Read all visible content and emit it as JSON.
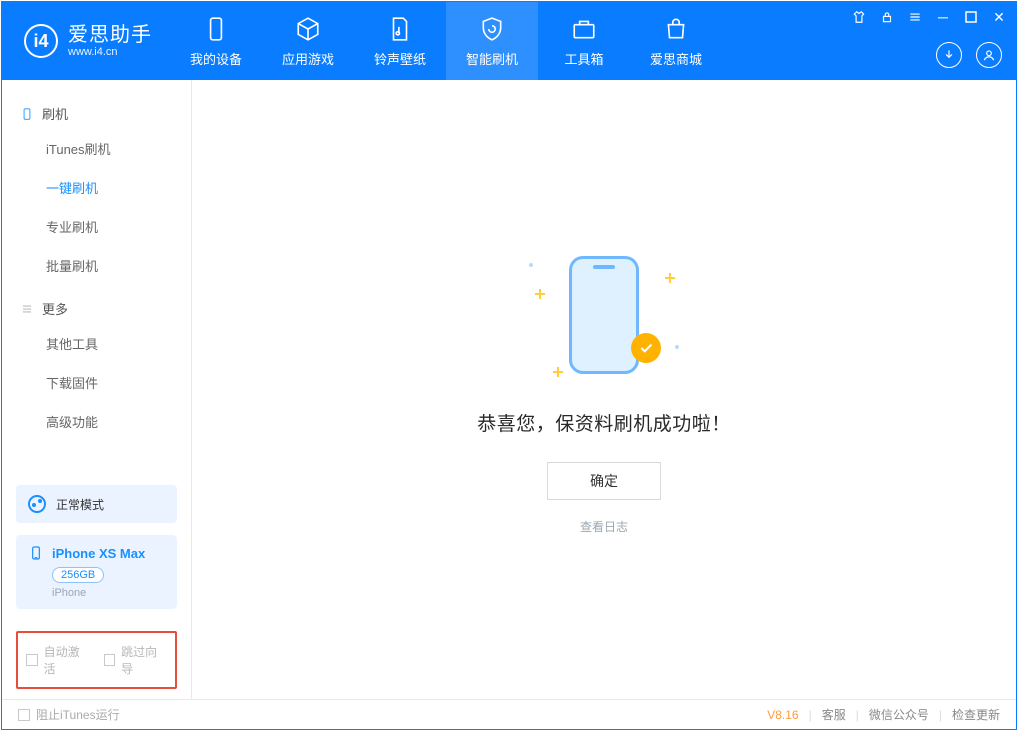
{
  "logo": {
    "cn": "爱思助手",
    "en": "www.i4.cn"
  },
  "topTabs": [
    {
      "label": "我的设备"
    },
    {
      "label": "应用游戏"
    },
    {
      "label": "铃声壁纸"
    },
    {
      "label": "智能刷机"
    },
    {
      "label": "工具箱"
    },
    {
      "label": "爱思商城"
    }
  ],
  "sidebar": {
    "group1": {
      "title": "刷机",
      "items": [
        {
          "label": "iTunes刷机"
        },
        {
          "label": "一键刷机"
        },
        {
          "label": "专业刷机"
        },
        {
          "label": "批量刷机"
        }
      ]
    },
    "group2": {
      "title": "更多",
      "items": [
        {
          "label": "其他工具"
        },
        {
          "label": "下载固件"
        },
        {
          "label": "高级功能"
        }
      ]
    }
  },
  "mode": {
    "label": "正常模式"
  },
  "device": {
    "name": "iPhone XS Max",
    "capacity": "256GB",
    "type": "iPhone"
  },
  "checks": {
    "autoActivate": "自动激活",
    "skipGuide": "跳过向导"
  },
  "main": {
    "successText": "恭喜您，保资料刷机成功啦！",
    "okButton": "确定",
    "logLink": "查看日志"
  },
  "footer": {
    "blockItunes": "阻止iTunes运行",
    "version": "V8.16",
    "links": {
      "service": "客服",
      "wechat": "微信公众号",
      "update": "检查更新"
    }
  }
}
